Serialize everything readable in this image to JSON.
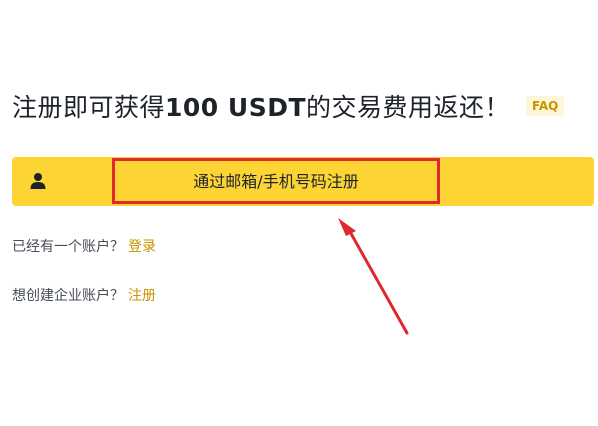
{
  "headline": {
    "prefix": "注册即可获得",
    "amount": "100 USDT",
    "suffix": "的交易费用返还！",
    "faq_label": "FAQ"
  },
  "signup_bar": {
    "icon": "person-icon",
    "label": "通过邮箱/手机号码注册"
  },
  "existing_account": {
    "text": "已经有一个账户？",
    "link": "登录"
  },
  "business_account": {
    "text": "想创建企业账户？",
    "link": "注册"
  },
  "colors": {
    "brand_yellow": "#fcd535",
    "link_gold": "#c99400",
    "annotation_red": "#e0282f"
  }
}
